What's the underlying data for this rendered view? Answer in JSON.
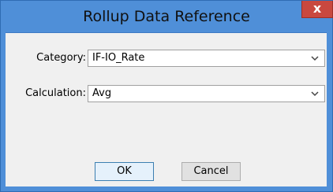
{
  "window": {
    "title": "Rollup Data Reference",
    "close_glyph": "x"
  },
  "form": {
    "category": {
      "label": "Category:",
      "value": "IF-IO_Rate"
    },
    "calculation": {
      "label": "Calculation:",
      "value": "Avg"
    }
  },
  "buttons": {
    "ok": "OK",
    "cancel": "Cancel"
  },
  "icons": {
    "close": "close-icon",
    "dropdown": "chevron-down-icon"
  },
  "colors": {
    "titlebar": "#4f8fd8",
    "close_button": "#c9483f",
    "client_bg": "#f0f0f0"
  }
}
